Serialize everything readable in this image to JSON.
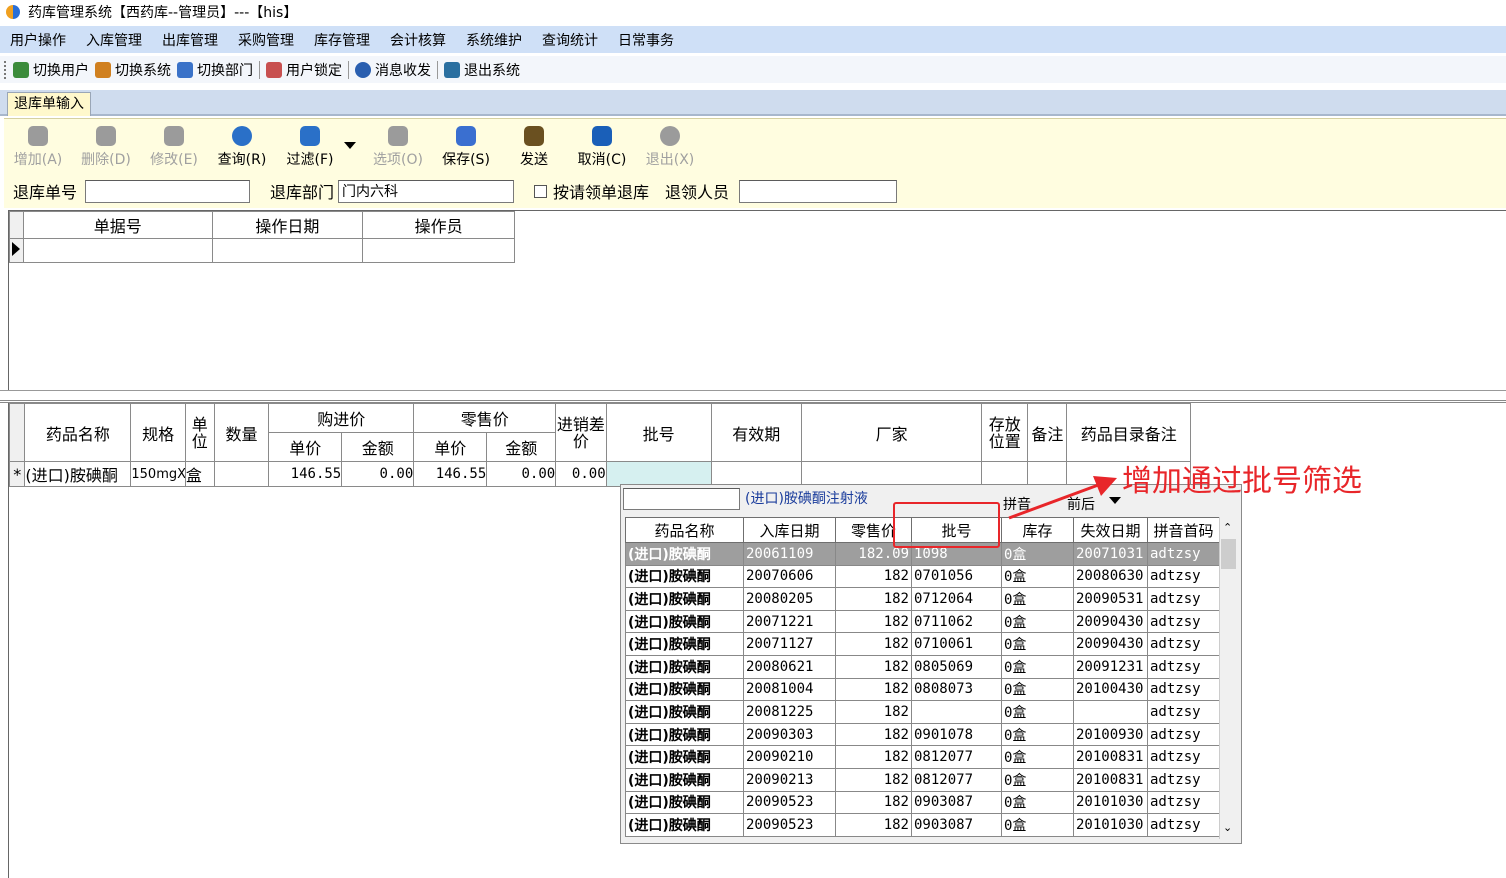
{
  "window": {
    "title": "药库管理系统【西药库--管理员】---【his】"
  },
  "menu": [
    "用户操作",
    "入库管理",
    "出库管理",
    "采购管理",
    "库存管理",
    "会计核算",
    "系统维护",
    "查询统计",
    "日常事务"
  ],
  "quicktoolbar": [
    {
      "label": "切换用户",
      "icon": "switch-user-icon",
      "color": "#3c8c3c"
    },
    {
      "label": "切换系统",
      "icon": "switch-system-icon",
      "color": "#d08020"
    },
    {
      "label": "切换部门",
      "icon": "switch-dept-icon",
      "color": "#3a72c8"
    },
    {
      "label": "用户锁定",
      "icon": "user-lock-icon",
      "color": "#c85050"
    },
    {
      "label": "消息收发",
      "icon": "message-icon",
      "color": "#2a5fb0"
    },
    {
      "label": "退出系统",
      "icon": "exit-system-icon",
      "color": "#2a6fa0"
    }
  ],
  "tab": {
    "label": "退库单输入"
  },
  "actions": [
    {
      "label": "增加(A)",
      "icon": "add-icon",
      "enabled": false
    },
    {
      "label": "删除(D)",
      "icon": "delete-icon",
      "enabled": false
    },
    {
      "label": "修改(E)",
      "icon": "edit-icon",
      "enabled": false
    },
    {
      "label": "查询(R)",
      "icon": "refresh-query-icon",
      "enabled": true,
      "color": "#2a70c8"
    },
    {
      "label": "过滤(F)",
      "icon": "filter-icon",
      "enabled": true,
      "color": "#2a70c8"
    },
    {
      "label": "选项(O)",
      "icon": "options-icon",
      "enabled": false
    },
    {
      "label": "保存(S)",
      "icon": "save-icon",
      "enabled": true,
      "color": "#3a6fd0"
    },
    {
      "label": "发送",
      "icon": "send-icon",
      "enabled": true,
      "color": "#6a5020"
    },
    {
      "label": "取消(C)",
      "icon": "cancel-icon",
      "enabled": true,
      "color": "#1a5fb8"
    },
    {
      "label": "退出(X)",
      "icon": "exit-icon",
      "enabled": false
    }
  ],
  "form": {
    "return_no_label": "退库单号",
    "return_no_value": "",
    "dept_label": "退库部门",
    "dept_value": "门内六科",
    "by_request_label": "按请领单退库",
    "person_label": "退领人员",
    "person_value": ""
  },
  "upper_grid": {
    "headers": [
      "单据号",
      "操作日期",
      "操作员"
    ]
  },
  "lower_grid": {
    "headers": {
      "name": "药品名称",
      "spec": "规格",
      "unit": "单位",
      "qty": "数量",
      "purchase": "购进价",
      "retail": "零售价",
      "unit_price": "单价",
      "amount": "金额",
      "diff": "进销差价",
      "batch": "批号",
      "expiry": "有效期",
      "maker": "厂家",
      "location": "存放位置",
      "remark": "备注",
      "catalog_remark": "药品目录备注"
    },
    "row": {
      "marker": "*",
      "name": "(进口)胺碘酮",
      "spec": "150mgX6",
      "unit": "盒",
      "p_price": "146.55",
      "p_amount": "0.00",
      "r_price": "146.55",
      "r_amount": "0.00",
      "diff": "0.00"
    }
  },
  "dropdown": {
    "search_value": "",
    "drug_title": "(进口)胺碘酮注射液",
    "mode_label": "拼音",
    "mode2_label": "前后",
    "headers": [
      "药品名称",
      "入库日期",
      "零售价",
      "批号",
      "库存",
      "失效日期",
      "拼音首码"
    ],
    "rows": [
      [
        "(进口)胺碘酮",
        "20061109",
        "182.09",
        "1098",
        "0盒",
        "20071031",
        "adtzsy"
      ],
      [
        "(进口)胺碘酮",
        "20070606",
        "182",
        "0701056",
        "0盒",
        "20080630",
        "adtzsy"
      ],
      [
        "(进口)胺碘酮",
        "20080205",
        "182",
        "0712064",
        "0盒",
        "20090531",
        "adtzsy"
      ],
      [
        "(进口)胺碘酮",
        "20071221",
        "182",
        "0711062",
        "0盒",
        "20090430",
        "adtzsy"
      ],
      [
        "(进口)胺碘酮",
        "20071127",
        "182",
        "0710061",
        "0盒",
        "20090430",
        "adtzsy"
      ],
      [
        "(进口)胺碘酮",
        "20080621",
        "182",
        "0805069",
        "0盒",
        "20091231",
        "adtzsy"
      ],
      [
        "(进口)胺碘酮",
        "20081004",
        "182",
        "0808073",
        "0盒",
        "20100430",
        "adtzsy"
      ],
      [
        "(进口)胺碘酮",
        "20081225",
        "182",
        "",
        "0盒",
        "",
        "adtzsy"
      ],
      [
        "(进口)胺碘酮",
        "20090303",
        "182",
        "0901078",
        "0盒",
        "20100930",
        "adtzsy"
      ],
      [
        "(进口)胺碘酮",
        "20090210",
        "182",
        "0812077",
        "0盒",
        "20100831",
        "adtzsy"
      ],
      [
        "(进口)胺碘酮",
        "20090213",
        "182",
        "0812077",
        "0盒",
        "20100831",
        "adtzsy"
      ],
      [
        "(进口)胺碘酮",
        "20090523",
        "182",
        "0903087",
        "0盒",
        "20101030",
        "adtzsy"
      ],
      [
        "(进口)胺碘酮",
        "20090523",
        "182",
        "0903087",
        "0盒",
        "20101030",
        "adtzsy"
      ]
    ]
  },
  "annotation": {
    "text": "增加通过批号筛选",
    "color": "#e8262a"
  }
}
